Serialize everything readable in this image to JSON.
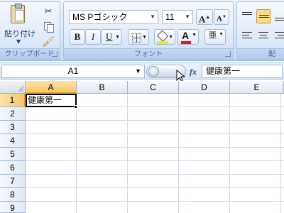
{
  "ribbon": {
    "clipboard": {
      "paste_label": "貼り付け",
      "group_label": "クリップボード",
      "icons": [
        "paste-icon",
        "cut-icon",
        "copy-icon",
        "format-painter-icon"
      ]
    },
    "font": {
      "font_name": "MS Pゴシック",
      "font_size": "11",
      "grow_label": "A",
      "shrink_label": "A",
      "bold_label": "B",
      "italic_label": "I",
      "underline_label": "U",
      "font_color_label": "A",
      "phonetic_label": "亜",
      "group_label": "フォント",
      "fill_color": "#f2f000",
      "font_color": "#e3131b"
    },
    "alignment": {
      "group_label": "配"
    }
  },
  "formula_bar": {
    "name_box": "A1",
    "fx_label": "fx",
    "formula": "健康第一"
  },
  "grid": {
    "columns": [
      "A",
      "B",
      "C",
      "D",
      "E"
    ],
    "rows": [
      "1",
      "2",
      "3",
      "4",
      "5",
      "6",
      "7",
      "8",
      "9"
    ],
    "active_cell": {
      "ref": "A1",
      "value": "健康第一"
    }
  },
  "colors": {
    "ribbon_bg": "#dbe7f7",
    "selected_header": "#f8c766",
    "gridline": "#d0d7e5"
  }
}
